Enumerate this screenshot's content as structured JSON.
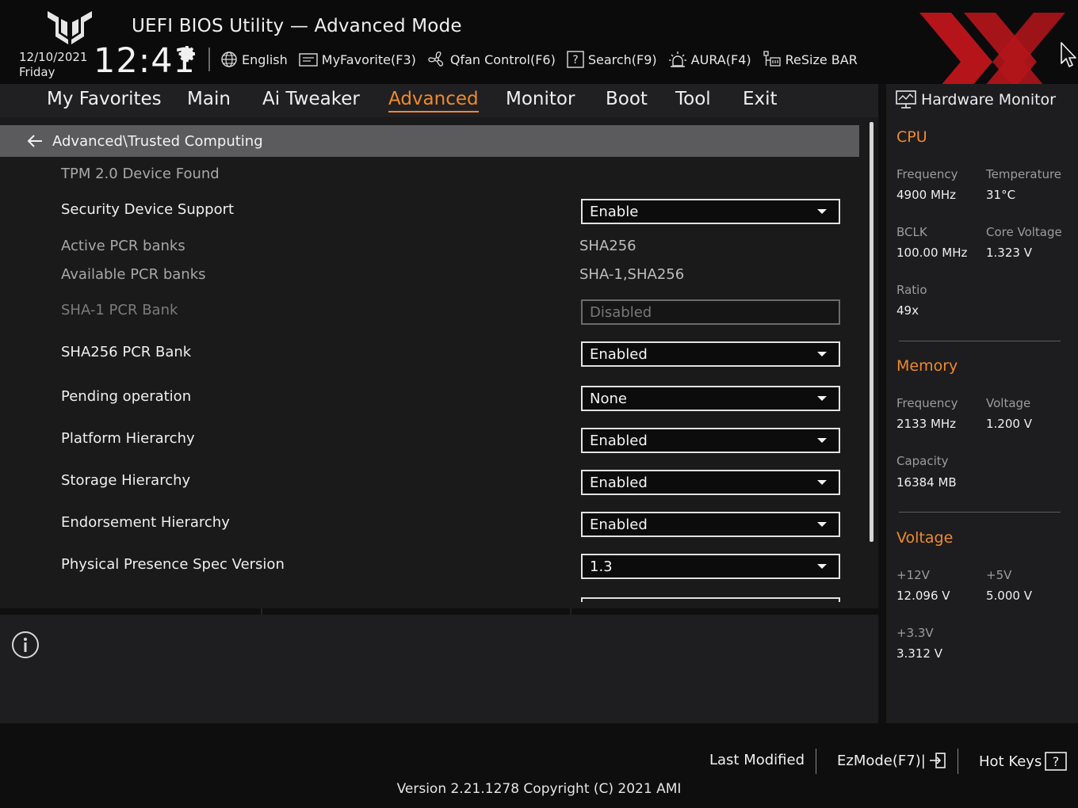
{
  "header": {
    "title": "UEFI BIOS Utility — Advanced Mode",
    "date": "12/10/2021",
    "day": "Friday",
    "time": "12:41",
    "toolbar": [
      {
        "label": "English",
        "icon": "globe-icon"
      },
      {
        "label": "MyFavorite(F3)",
        "icon": "favorite-icon"
      },
      {
        "label": "Qfan Control(F6)",
        "icon": "fan-icon"
      },
      {
        "label": "Search(F9)",
        "icon": "search-help-icon"
      },
      {
        "label": "AURA(F4)",
        "icon": "aura-icon"
      },
      {
        "label": "ReSize BAR",
        "icon": "resize-bar-icon"
      }
    ]
  },
  "menu": {
    "items": [
      "My Favorites",
      "Main",
      "Ai Tweaker",
      "Advanced",
      "Monitor",
      "Boot",
      "Tool",
      "Exit"
    ],
    "active": "Advanced"
  },
  "content": {
    "breadcrumb": "Advanced\\Trusted Computing",
    "tpm_status": "TPM 2.0 Device Found",
    "security_device_support": {
      "label": "Security Device Support",
      "value": "Enable"
    },
    "active_pcr_banks": {
      "label": "Active PCR banks",
      "value": "SHA256"
    },
    "available_pcr_banks": {
      "label": "Available PCR banks",
      "value": "SHA-1,SHA256"
    },
    "sha1_pcr_bank": {
      "label": "SHA-1 PCR Bank",
      "value": "Disabled"
    },
    "sha256_pcr_bank": {
      "label": "SHA256 PCR Bank",
      "value": "Enabled"
    },
    "pending_operation": {
      "label": "Pending operation",
      "value": "None"
    },
    "platform_hierarchy": {
      "label": "Platform Hierarchy",
      "value": "Enabled"
    },
    "storage_hierarchy": {
      "label": "Storage Hierarchy",
      "value": "Enabled"
    },
    "endorsement_hierarchy": {
      "label": "Endorsement Hierarchy",
      "value": "Enabled"
    },
    "physical_presence": {
      "label": "Physical Presence Spec Version",
      "value": "1.3"
    }
  },
  "hw_monitor": {
    "title": "Hardware Monitor",
    "cpu": {
      "heading": "CPU",
      "frequency_label": "Frequency",
      "frequency": "4900 MHz",
      "temperature_label": "Temperature",
      "temperature": "31°C",
      "bclk_label": "BCLK",
      "bclk": "100.00 MHz",
      "core_voltage_label": "Core Voltage",
      "core_voltage": "1.323 V",
      "ratio_label": "Ratio",
      "ratio": "49x"
    },
    "memory": {
      "heading": "Memory",
      "frequency_label": "Frequency",
      "frequency": "2133 MHz",
      "voltage_label": "Voltage",
      "voltage": "1.200 V",
      "capacity_label": "Capacity",
      "capacity": "16384 MB"
    },
    "voltage": {
      "heading": "Voltage",
      "v12_label": "+12V",
      "v12": "12.096 V",
      "v5_label": "+5V",
      "v5": "5.000 V",
      "v33_label": "+3.3V",
      "v33": "3.312 V"
    }
  },
  "footer": {
    "last_modified": "Last Modified",
    "ezmode": "EzMode(F7)|",
    "hot_keys": "Hot Keys",
    "version": "Version 2.21.1278 Copyright (C) 2021 AMI"
  },
  "colors": {
    "accent": "#f08a2c",
    "watermark": "#c4161c"
  }
}
